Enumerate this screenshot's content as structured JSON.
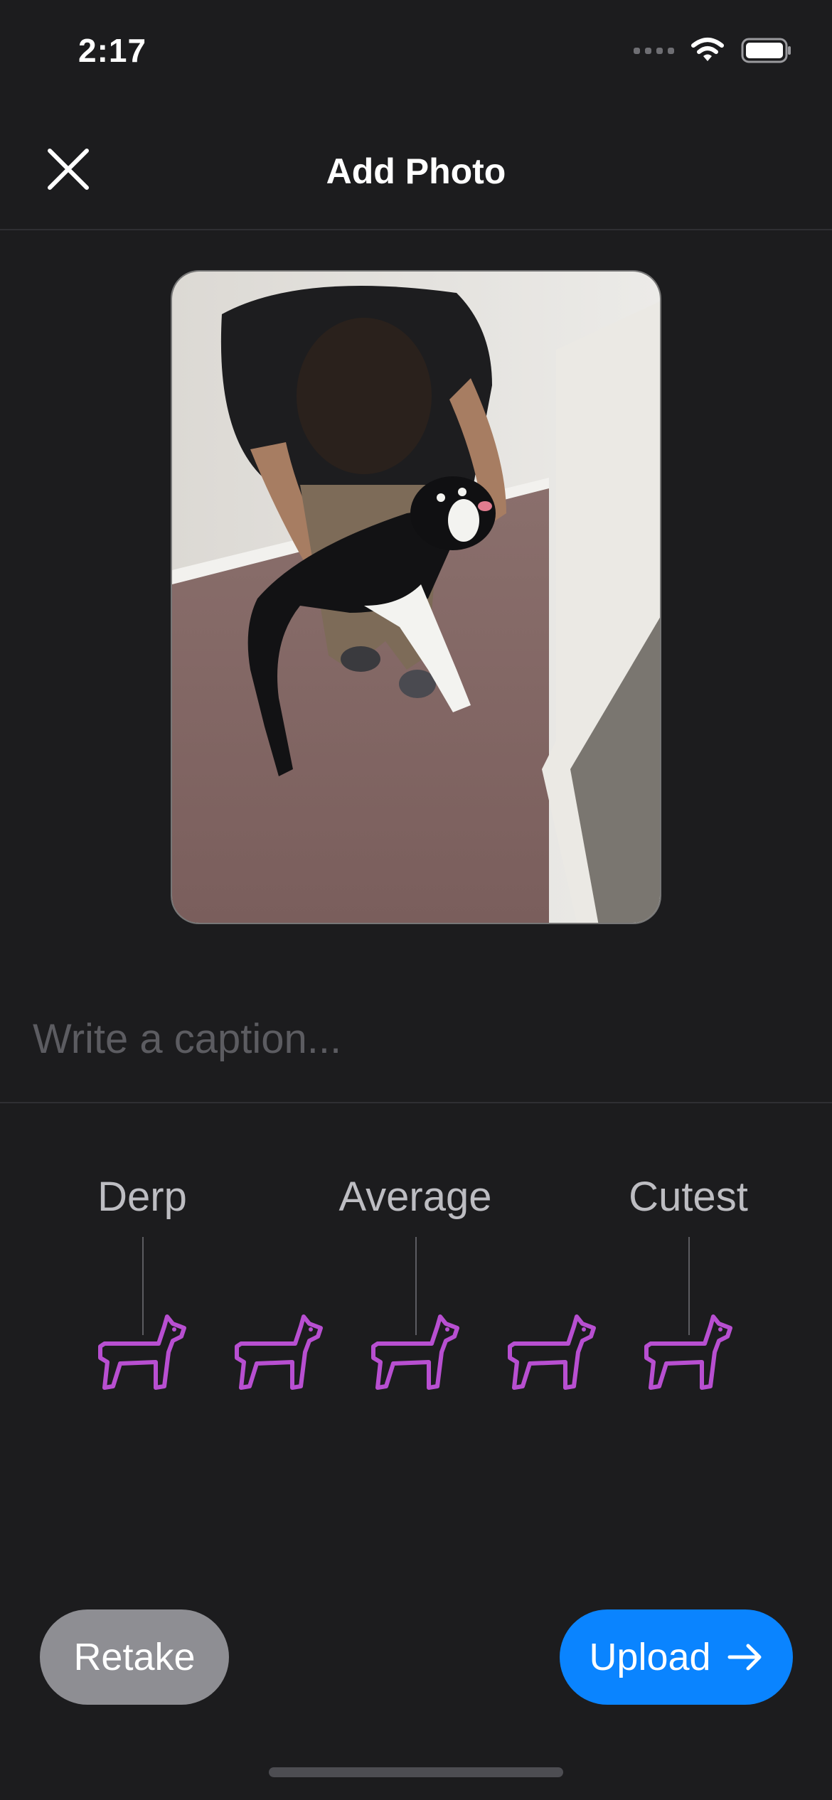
{
  "status_bar": {
    "time": "2:17"
  },
  "nav": {
    "title": "Add Photo"
  },
  "caption": {
    "placeholder": "Write a caption..."
  },
  "rating": {
    "labels": [
      "Derp",
      "Average",
      "Cutest"
    ],
    "max": 5,
    "value": 0,
    "icon_color": "#b84fd1"
  },
  "actions": {
    "retake_label": "Retake",
    "upload_label": "Upload"
  },
  "colors": {
    "accent": "#0a84ff",
    "background": "#1c1c1e",
    "secondary_button": "#8e8e93"
  }
}
